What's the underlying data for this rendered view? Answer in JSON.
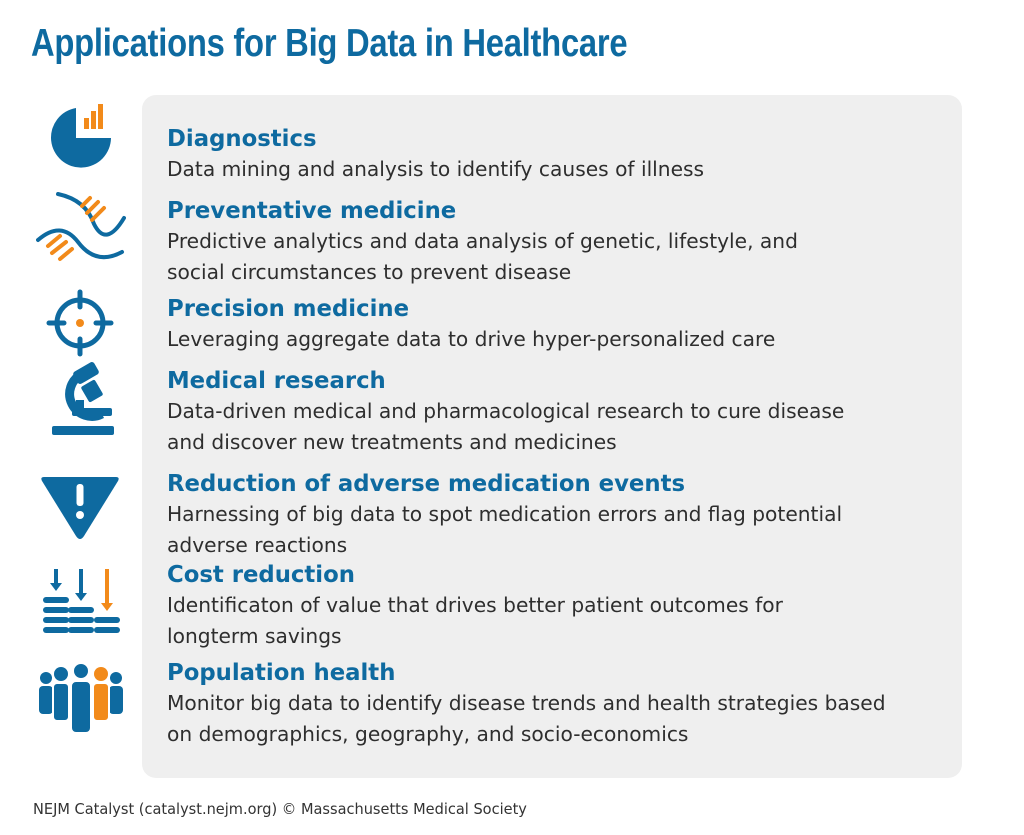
{
  "title": "Applications for Big Data in Healthcare",
  "colors": {
    "blue": "#0e6aa0",
    "orange": "#f28a1a",
    "panel": "#efefef",
    "text": "#2e2e2e"
  },
  "items": [
    {
      "icon": "pie-chart-bar-icon",
      "heading": "Diagnostics",
      "lines": [
        "Data mining and analysis to identify causes of illness"
      ]
    },
    {
      "icon": "dna-helix-icon",
      "heading": "Preventative medicine",
      "lines": [
        "Predictive analytics and data analysis of genetic, lifestyle, and",
        "social circumstances to prevent disease"
      ]
    },
    {
      "icon": "crosshair-target-icon",
      "heading": "Precision medicine",
      "lines": [
        "Leveraging aggregate data to drive hyper-personalized care"
      ]
    },
    {
      "icon": "microscope-icon",
      "heading": "Medical research",
      "lines": [
        "Data-driven medical and pharmacological research to cure disease",
        "and discover new treatments and medicines"
      ]
    },
    {
      "icon": "warning-triangle-icon",
      "heading": "Reduction of adverse medication events",
      "lines": [
        "Harnessing of big data to spot medication errors and flag potential",
        "adverse reactions"
      ]
    },
    {
      "icon": "cost-reduction-icon",
      "heading": "Cost reduction",
      "lines": [
        "Identificaton of value that drives better patient outcomes for",
        "longterm savings"
      ]
    },
    {
      "icon": "population-group-icon",
      "heading": "Population health",
      "lines": [
        "Monitor big data to identify disease trends and health strategies based",
        "on demographics, geography, and socio-economics"
      ]
    }
  ],
  "footer": "NEJM Catalyst (catalyst.nejm.org) © Massachusetts Medical Society"
}
